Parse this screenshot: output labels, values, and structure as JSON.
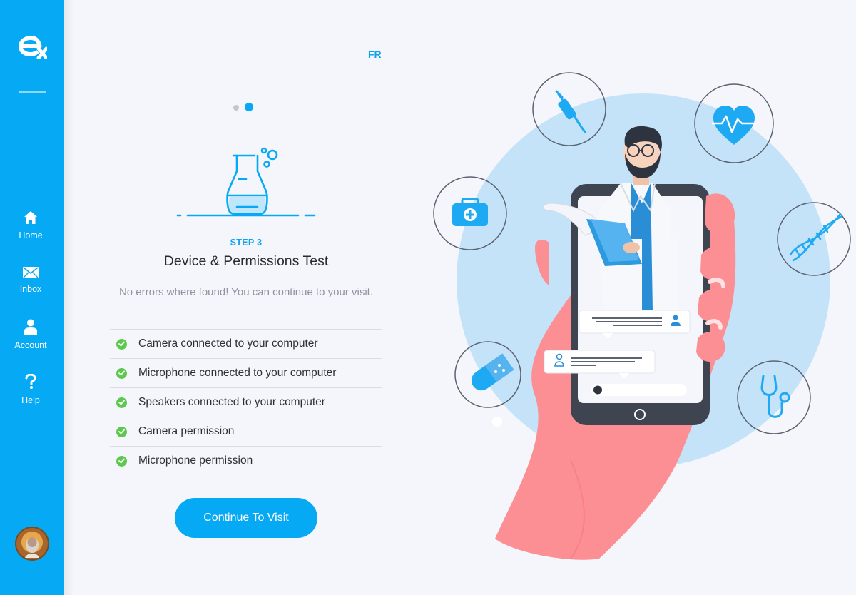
{
  "sidebar": {
    "logo_icon": "brand-logo",
    "items": [
      {
        "label": "Home",
        "icon": "home-icon"
      },
      {
        "label": "Inbox",
        "icon": "mail-icon"
      },
      {
        "label": "Account",
        "icon": "user-icon"
      },
      {
        "label": "Help",
        "icon": "help-icon"
      }
    ],
    "accent": "#05a9f4"
  },
  "header": {
    "language_toggle": "FR"
  },
  "wizard": {
    "total_steps_dots": 2,
    "active_dot": 2,
    "step_label": "STEP 3",
    "title": "Device & Permissions Test",
    "subtitle": "No errors where found! You can continue to your visit.",
    "checks": [
      {
        "label": "Camera connected to your computer",
        "status": "ok"
      },
      {
        "label": "Microphone connected to your computer",
        "status": "ok"
      },
      {
        "label": "Speakers connected to your computer",
        "status": "ok"
      },
      {
        "label": "Camera permission",
        "status": "ok"
      },
      {
        "label": "Microphone permission",
        "status": "ok"
      }
    ],
    "continue_label": "Continue To Visit"
  },
  "colors": {
    "primary": "#05a9f4",
    "success": "#5cc94c",
    "text_dark": "#2b2b33",
    "text_muted": "#8d93a1"
  }
}
